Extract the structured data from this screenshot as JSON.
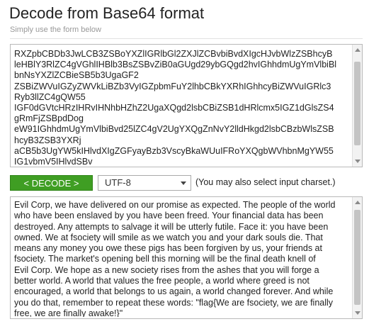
{
  "header": {
    "title": "Decode from Base64 format",
    "subtitle": "Simply use the form below"
  },
  "input": {
    "value": "RXZpbCBDb3JwLCB3ZSBoYXZlIGRlbGl2ZXJlZCBvbiBvdXIgcHJvbWlzZSBhcyB\nleHBlY3RlZC4gVGhlIHBlb3BsZSBvZiB0aGUgd29ybGQgd2hvIGhhdmUgYmVlbiBl\nbnNsYXZlZCBieSB5b3UgaGF2\nZSBiZWVuIGZyZWVkLiBZb3VyIGZpbmFuY2lhbCBkYXRhIGhhcyBiZWVuIGRlc3\nRyb3llZC4gQW55\nIGF0dGVtcHRzIHRvIHNhbHZhZ2UgaXQgd2lsbCBiZSB1dHRlcmx5IGZ1dGlsZS4\ngRmFjZSBpdDog\neW91IGhhdmUgYmVlbiBvd25lZC4gV2UgYXQgZnNvY2lldHkgd2lsbCBzbWlsZSB\nhcyB3ZSB3YXRj\naCB5b3UgYW5kIHlvdXIgZGFyayBzb3VscyBkaWUuIFRoYXQgbWVhbnMgYW55\nIG1vbmV5IHlvdSBv"
  },
  "controls": {
    "decode_label": "< DECODE >",
    "charset_value": "UTF-8",
    "charset_note": "(You may also select input charset.)"
  },
  "output": {
    "value": "Evil Corp, we have delivered on our promise as expected. The people of the world\nwho have been enslaved by you have been freed. Your financial data has been\ndestroyed. Any attempts to salvage it will be utterly futile. Face it: you have been\nowned. We at fsociety will smile as we watch you and your dark souls die. That\nmeans any money you owe these pigs has been forgiven by us, your friends at\nfsociety. The market's opening bell this morning will be the final death knell of\nEvil Corp. We hope as a new society rises from the ashes that you will forge a\nbetter world. A world that values the free people, a world where greed is not\nencouraged, a world that belongs to us again, a world changed forever. And while\nyou do that, remember to repeat these words: \"flag{We are fsociety, we are finally\nfree, we are finally awake!}\""
  }
}
